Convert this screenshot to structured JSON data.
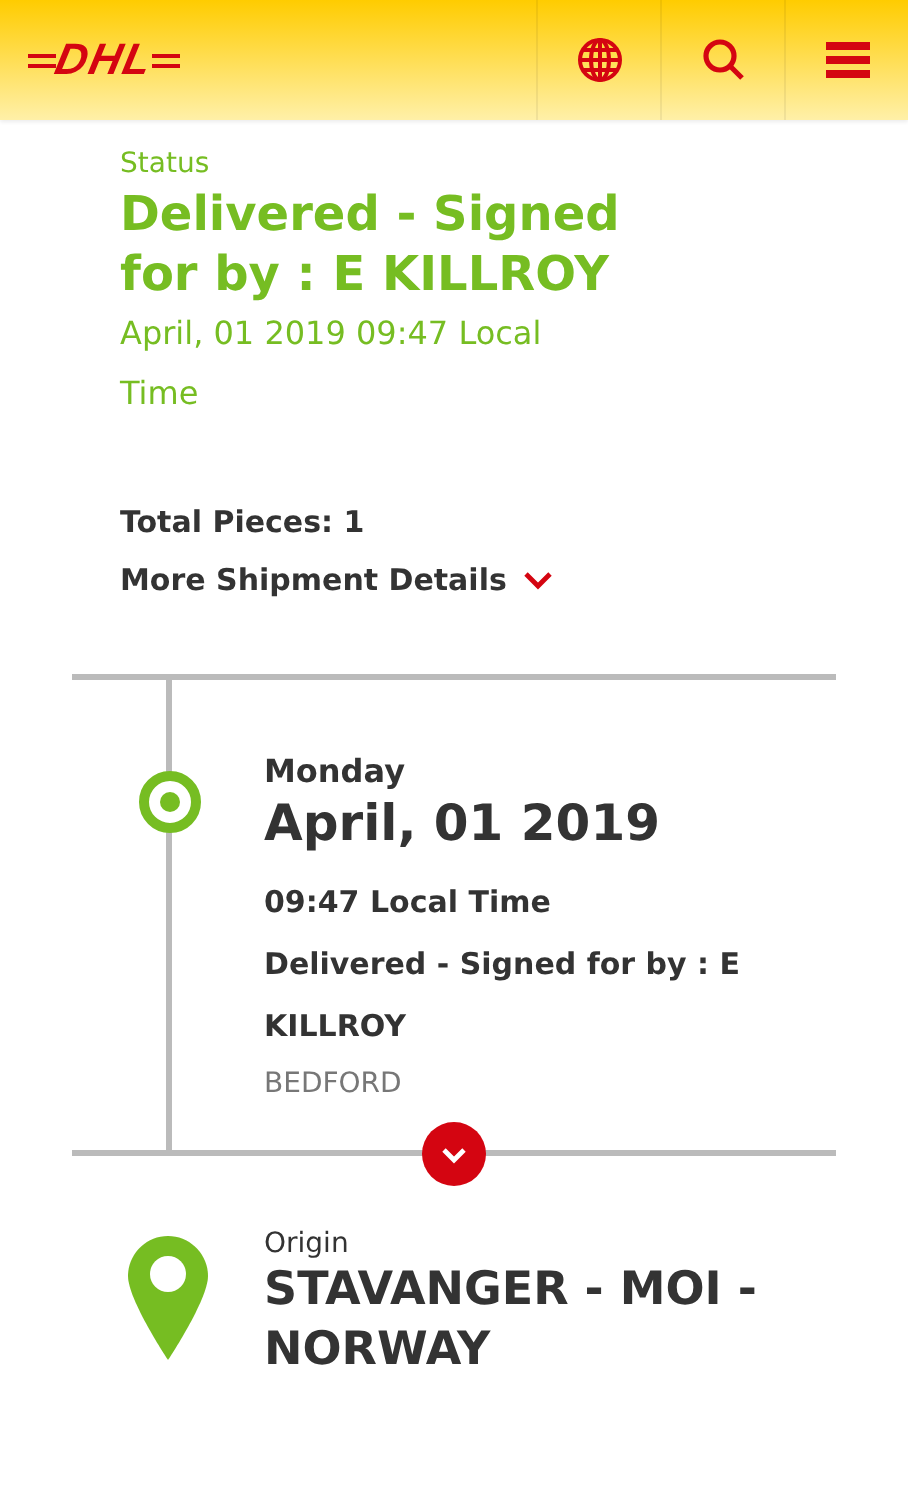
{
  "header": {
    "logo": "DHL"
  },
  "status": {
    "label": "Status",
    "headline": "Delivered - Signed for by : E KILLROY",
    "datetime": "April, 01 2019 09:47 Local Time"
  },
  "total_pieces": "Total Pieces: 1",
  "more_details": {
    "label": "More Shipment Details",
    "expanded": false
  },
  "event": {
    "weekday": "Monday",
    "date": "April, 01 2019",
    "time": "09:47 Local Time",
    "description": "Delivered - Signed for by : E KILLROY",
    "location": "BEDFORD"
  },
  "origin": {
    "label": "Origin",
    "place": "STAVANGER - MOI - NORWAY"
  }
}
